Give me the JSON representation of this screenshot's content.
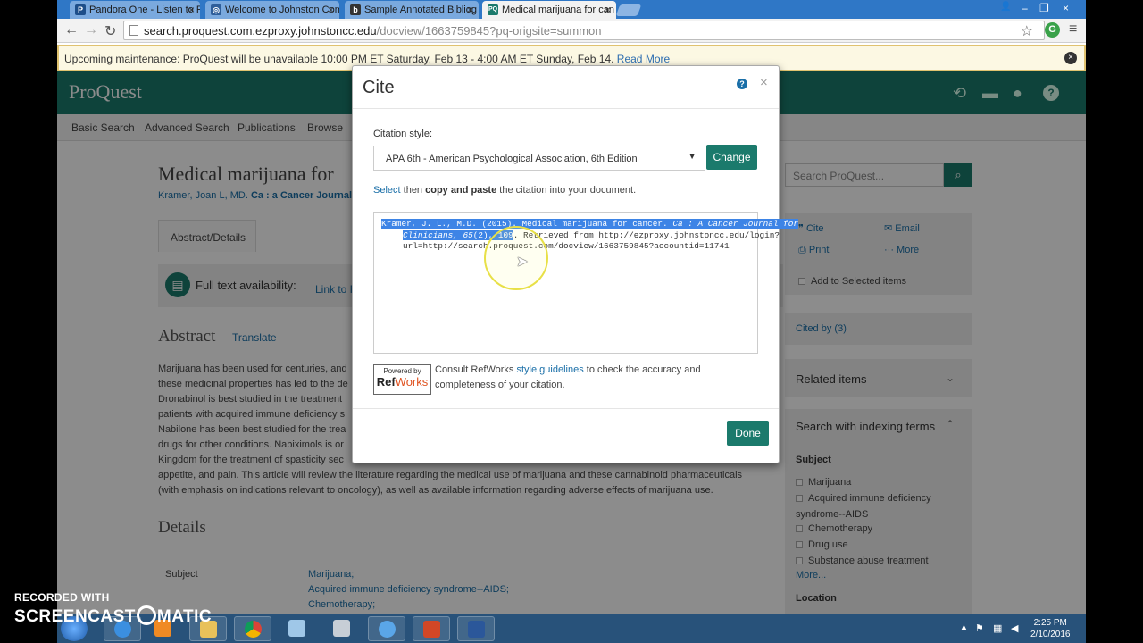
{
  "browser": {
    "tabs": [
      {
        "label": "Pandora One - Listen to Pa",
        "favicon": "P",
        "favicon_color": "#1d4e89"
      },
      {
        "label": "Welcome to Johnston Com",
        "favicon": "◎",
        "favicon_color": "#2e5e9a"
      },
      {
        "label": "Sample Annotated Bibliog",
        "favicon": "b",
        "favicon_color": "#333333"
      },
      {
        "label": "Medical marijuana for can",
        "favicon": "PQ",
        "favicon_color": "#1b7a6c"
      }
    ],
    "tab_close": "×",
    "window_controls": {
      "user": "👤",
      "minimize": "–",
      "restore": "❐",
      "close": "×"
    },
    "url_host": "search.proquest.com.ezproxy.johnstoncc.edu",
    "url_path": "/docview/1663759845?pq-origsite=summon"
  },
  "banner": {
    "text": "Upcoming maintenance: ProQuest will be unavailable 10:00 PM ET Saturday, Feb 13 - 4:00 AM ET Sunday, Feb 14.",
    "link": "Read More",
    "close": "×"
  },
  "proquest": {
    "logo": "ProQuest",
    "nav": [
      "Basic Search",
      "Advanced Search",
      "Publications",
      "Browse"
    ],
    "icons": {
      "history": "⟲",
      "folder": "▬",
      "user": "●",
      "help": "?"
    }
  },
  "doc": {
    "title": "Medical marijuana for",
    "author_prefix": "Kramer, Joan L, MD.",
    "journal": "Ca : a Cancer Journal f",
    "tab": "Abstract/Details",
    "fulltext_label": "Full text availability:",
    "fulltext_link": "Link to F",
    "abstract_heading": "Abstract",
    "translate": "Translate",
    "abstract_lines": [
      "Marijuana has been used for centuries, and",
      "these medicinal properties has led to the de",
      "Dronabinol is best studied in the treatment",
      "patients with acquired immune deficiency s",
      "Nabilone has been best studied for the trea",
      "drugs for other conditions. Nabiximols is or",
      "Kingdom for the treatment of spasticity sec",
      "appetite, and pain. This article will review the literature regarding the medical use of marijuana and these cannabinoid pharmaceuticals",
      "(with emphasis on indications relevant to oncology), as well as available information regarding adverse effects of marijuana use."
    ],
    "details_heading": "Details",
    "subject_label": "Subject",
    "subject_values": [
      "Marijuana;",
      "Acquired immune deficiency syndrome--AIDS;",
      "Chemotherapy;"
    ]
  },
  "sidebar": {
    "search_placeholder": "Search ProQuest...",
    "actions": {
      "cite": "Cite",
      "email": "Email",
      "print": "Print",
      "more": "More"
    },
    "add_selected": "Add to Selected items",
    "cited_by": "Cited by (3)",
    "related": "Related items",
    "indexing": "Search with indexing terms",
    "subject_heading": "Subject",
    "terms": [
      "Marijuana",
      "Acquired immune deficiency",
      "syndrome--AIDS",
      "Chemotherapy",
      "Drug use",
      "Substance abuse treatment"
    ],
    "more_link": "More...",
    "location_heading": "Location"
  },
  "modal": {
    "title": "Cite",
    "close": "×",
    "style_label": "Citation style:",
    "style_value": "APA 6th - American Psychological Association, 6th Edition",
    "change_button": "Change",
    "instr_select": "Select",
    "instr_then": "then",
    "instr_bold": "copy and paste",
    "instr_rest": "the citation into your document.",
    "citation": {
      "line1_a": "Kramer, J. L., M.D. (2015). Medical marijuana for cancer. ",
      "line1_b": "Ca : A Cancer Journal for",
      "line2_a": "Clinicians, 65",
      "line2_b": "(2), 109",
      "line2_c": ". Retrieved from http://ezproxy.johnstoncc.edu/login?",
      "line3": "url=http://search.proquest.com/docview/1663759845?accountid=11741"
    },
    "refworks_small": "Powered by",
    "refworks_ref": "Ref",
    "refworks_works": "Works",
    "rw_text_a": "Consult RefWorks",
    "rw_text_link": "style guidelines",
    "rw_text_b": "to check the accuracy and completeness of your citation.",
    "done_button": "Done"
  },
  "taskbar": {
    "time": "2:25 PM",
    "date": "2/10/2016",
    "apps": [
      "start-orb",
      "internet-explorer",
      "media-player",
      "file-explorer",
      "chrome",
      "paint",
      "calculator",
      "media-center",
      "powerpoint",
      "word"
    ]
  },
  "watermark": {
    "top": "RECORDED WITH",
    "big_a": "SCREENCAST",
    "big_b": "MATIC"
  }
}
